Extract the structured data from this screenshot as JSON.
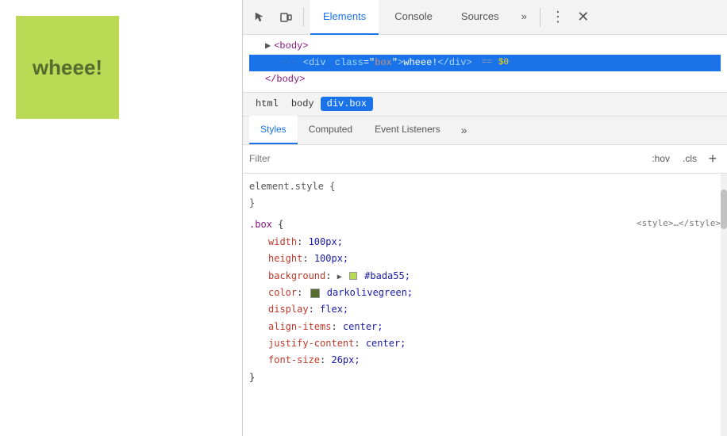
{
  "page": {
    "demo_box_text": "wheee!"
  },
  "devtools": {
    "toolbar": {
      "inspect_icon": "⊹",
      "device_icon": "⬜",
      "tabs": [
        {
          "label": "Elements",
          "active": true
        },
        {
          "label": "Console",
          "active": false
        },
        {
          "label": "Sources",
          "active": false
        }
      ],
      "more_tabs_icon": "»",
      "dots_icon": "⋮",
      "close_icon": "✕"
    },
    "elements": {
      "lines": [
        {
          "indent": 1,
          "content": "▶ <body>",
          "selected": false
        },
        {
          "indent": 2,
          "content": "<div class=\"box\">wheee!</div>",
          "selected": true,
          "has_equals": true
        },
        {
          "indent": 1,
          "content": "</body>",
          "selected": false
        }
      ]
    },
    "breadcrumb": [
      {
        "label": "html",
        "active": false
      },
      {
        "label": "body",
        "active": false
      },
      {
        "label": "div.box",
        "active": true
      }
    ],
    "styles_tabs": [
      {
        "label": "Styles",
        "active": true
      },
      {
        "label": "Computed",
        "active": false
      },
      {
        "label": "Event Listeners",
        "active": false
      }
    ],
    "filter": {
      "placeholder": "Filter",
      "hov_label": ":hov",
      "cls_label": ".cls",
      "plus_icon": "+"
    },
    "css_blocks": [
      {
        "selector": "element.style",
        "source": "",
        "properties": []
      },
      {
        "selector": ".box",
        "source": "<style>…</style>",
        "properties": [
          {
            "name": "width",
            "value": "100px;"
          },
          {
            "name": "height",
            "value": "100px;"
          },
          {
            "name": "background",
            "value": "#bada55;",
            "has_color": true,
            "color": "#bada55",
            "has_arrow": true
          },
          {
            "name": "color",
            "value": "darkolivegreen;",
            "has_cursor_swatch": true
          },
          {
            "name": "display",
            "value": "flex;"
          },
          {
            "name": "align-items",
            "value": "center;"
          },
          {
            "name": "justify-content",
            "value": "center;"
          },
          {
            "name": "font-size",
            "value": "26px;"
          }
        ]
      }
    ]
  }
}
